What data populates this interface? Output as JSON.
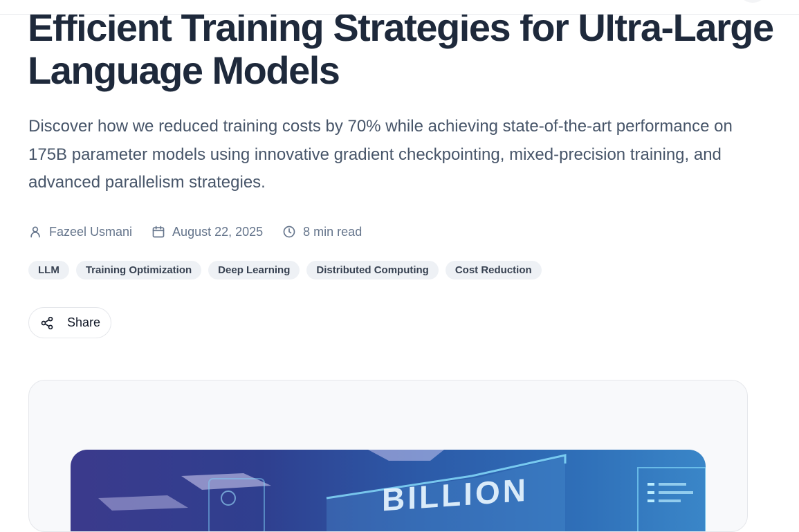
{
  "article": {
    "title": "Efficient Training Strategies for Ultra-Large Language Models",
    "subtitle": "Discover how we reduced training costs by 70% while achieving state-of-the-art performance on 175B parameter models using innovative gradient checkpointing, mixed-precision training, and advanced parallelism strategies.",
    "author": "Fazeel Usmani",
    "date": "August 22, 2025",
    "read_time": "8 min read",
    "tags": [
      "LLM",
      "Training Optimization",
      "Deep Learning",
      "Distributed Computing",
      "Cost Reduction"
    ],
    "share_label": "Share"
  },
  "hero_image": {
    "visible_text": "BILLION"
  },
  "colors": {
    "title": "#1e293b",
    "subtitle": "#475569",
    "meta": "#64748b",
    "tag_bg": "#eef1f5",
    "hero_start": "#3b3a8c",
    "hero_end": "#3a86c8"
  },
  "icons": {
    "author": "user-icon",
    "date": "calendar-icon",
    "read_time": "clock-icon",
    "share": "share-icon"
  }
}
